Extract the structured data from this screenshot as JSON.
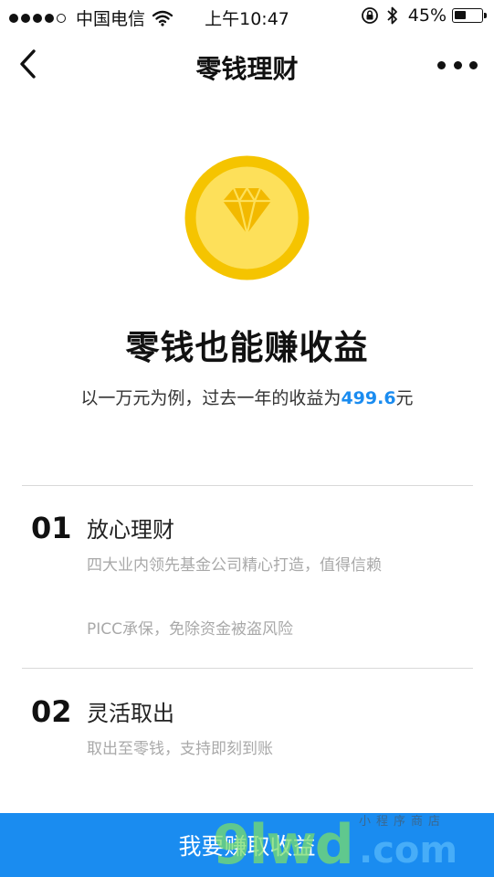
{
  "status_bar": {
    "carrier": "中国电信",
    "time": "上午10:47",
    "battery_percent": "45%",
    "battery_level": 0.45
  },
  "nav": {
    "title": "零钱理财"
  },
  "hero": {
    "title": "零钱也能赚收益",
    "subtitle_prefix": "以一万元为例，过去一年的收益为",
    "amount": "499.6",
    "subtitle_suffix": "元"
  },
  "features": [
    {
      "number": "01",
      "title": "放心理财",
      "lines": [
        "四大业内领先基金公司精心打造，值得信赖",
        "PICC承保，免除资金被盗风险"
      ]
    },
    {
      "number": "02",
      "title": "灵活取出",
      "lines": [
        "取出至零钱，支持即刻到账"
      ]
    }
  ],
  "cta": {
    "label": "我要赚取收益"
  },
  "watermark": {
    "main": "9lwd",
    "com": ".com",
    "small": "小程序商店"
  },
  "colors": {
    "accent": "#1a8cf0",
    "coin_outer": "#f5c400",
    "coin_inner": "#fde05a"
  }
}
